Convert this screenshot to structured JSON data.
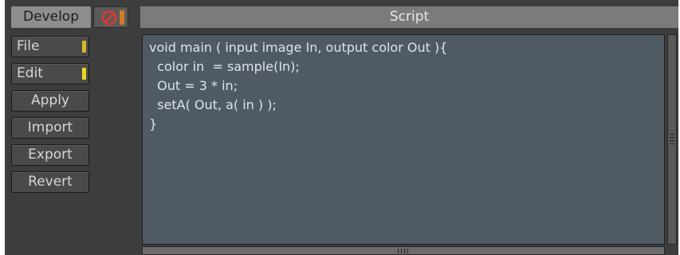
{
  "panel": {
    "develop_label": "Develop",
    "stop_icon": "no-entry-icon"
  },
  "sidebar": {
    "buttons": [
      {
        "label": "File",
        "led_color": "#d9b82a"
      },
      {
        "label": "Edit",
        "led_color": "#e8d820"
      },
      {
        "label": "Apply"
      },
      {
        "label": "Import"
      },
      {
        "label": "Export"
      },
      {
        "label": "Revert"
      }
    ]
  },
  "script": {
    "title": "Script",
    "lines": [
      "void main ( input image In, output color Out ){",
      "  color in  = sample(In);",
      "  Out = 3 * in;",
      "  setA( Out, a( in ) );",
      "}"
    ]
  },
  "colors": {
    "editor_bg": "#4f5a63",
    "stop_icon": "#e03a2e",
    "accent_orange": "#d07a2a"
  }
}
